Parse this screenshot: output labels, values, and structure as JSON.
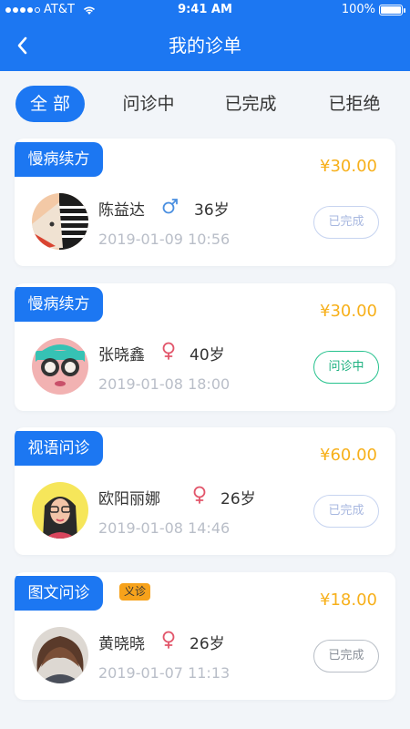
{
  "status_bar": {
    "carrier": "AT&T",
    "time": "9:41 AM",
    "battery": "100%"
  },
  "nav": {
    "title": "我的诊单",
    "back_icon": "chevron-left-icon"
  },
  "tabs": [
    {
      "label": "全部",
      "active": true
    },
    {
      "label": "问诊中",
      "active": false
    },
    {
      "label": "已完成",
      "active": false
    },
    {
      "label": "已拒绝",
      "active": false
    }
  ],
  "orders": [
    {
      "type": "慢病续方",
      "price": "¥30.00",
      "name": "陈益达",
      "gender": "male",
      "age": "36岁",
      "date": "2019-01-09 10:56",
      "status": "已完成",
      "badge": ""
    },
    {
      "type": "慢病续方",
      "price": "¥30.00",
      "name": "张晓鑫",
      "gender": "female",
      "age": "40岁",
      "date": "2019-01-08 18:00",
      "status": "问诊中",
      "badge": ""
    },
    {
      "type": "视语问诊",
      "price": "¥60.00",
      "name": "欧阳丽娜",
      "gender": "female",
      "age": "26岁",
      "date": "2019-01-08 14:46",
      "status": "已完成",
      "badge": ""
    },
    {
      "type": "图文问诊",
      "price": "¥18.00",
      "name": "黄晓晓",
      "gender": "female",
      "age": "26岁",
      "date": "2019-01-07 11:13",
      "status": "已完成",
      "badge": "义诊"
    }
  ],
  "colors": {
    "primary": "#1c77f2",
    "price": "#f7b01b",
    "male": "#4a8fe0",
    "female": "#e2556a",
    "in_progress": "#1bb07f"
  }
}
